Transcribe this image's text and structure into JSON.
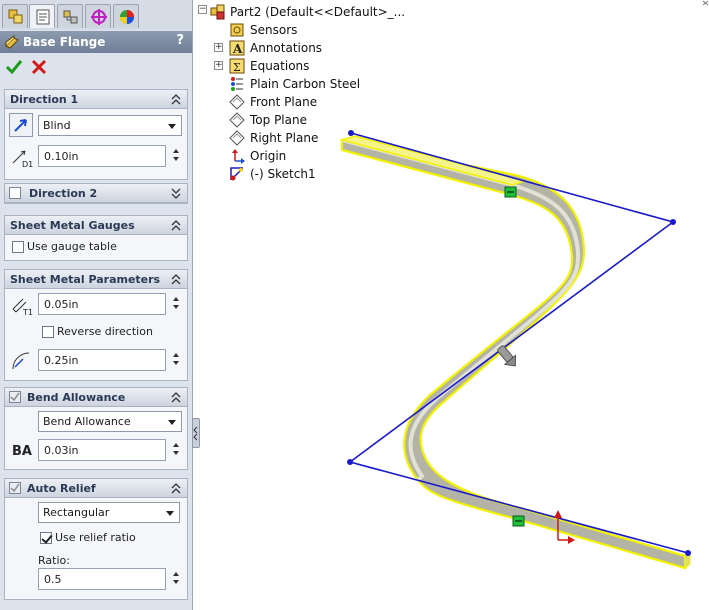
{
  "property_manager": {
    "title": "Base Flange",
    "help": "?",
    "tabs": [
      "feature-manager-tab",
      "property-manager-tab",
      "configuration-manager-tab",
      "dim-xpert-tab",
      "display-manager-tab"
    ],
    "ok": "ok-checkmark",
    "cancel": "cancel-x",
    "direction1": {
      "title": "Direction 1",
      "end_condition": "Blind",
      "depth": "0.10in"
    },
    "direction2": {
      "title": "Direction 2",
      "checked": false
    },
    "gauges": {
      "title": "Sheet Metal Gauges",
      "use_gauge_table": "Use gauge table",
      "use_gauge_table_checked": false
    },
    "parameters": {
      "title": "Sheet Metal Parameters",
      "thickness": "0.05in",
      "reverse_direction": "Reverse direction",
      "reverse_checked": false,
      "bend_radius": "0.25in"
    },
    "bend_allowance": {
      "title": "Bend Allowance",
      "type": "Bend Allowance",
      "ba_label": "BA",
      "value": "0.03in"
    },
    "auto_relief": {
      "title": "Auto Relief",
      "type": "Rectangular",
      "use_relief_ratio": "Use relief ratio",
      "use_relief_ratio_checked": true,
      "ratio_label": "Ratio:",
      "ratio": "0.5"
    }
  },
  "tree": {
    "root": "Part2  (Default<<Default>_...",
    "items": [
      "Sensors",
      "Annotations",
      "Equations",
      "Plain Carbon Steel",
      "Front Plane",
      "Top Plane",
      "Right Plane",
      "Origin",
      "(-) Sketch1"
    ]
  },
  "colors": {
    "sketch": "#1a1acc",
    "highlight": "#f0f000",
    "body": "#a8a89a",
    "accent": "#00b050"
  }
}
